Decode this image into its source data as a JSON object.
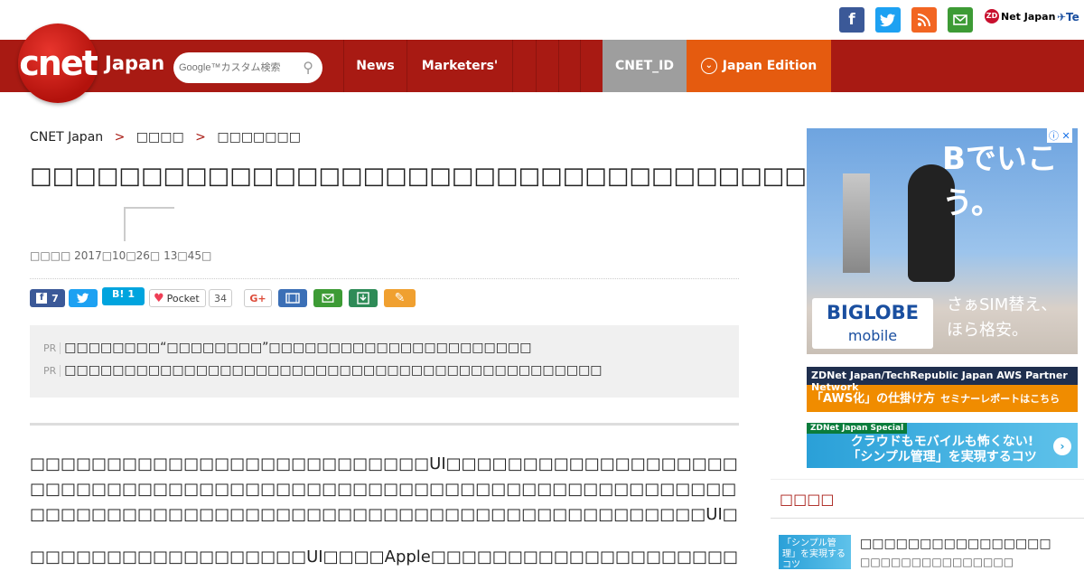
{
  "header": {
    "logo": "cnet",
    "site_name": "Japan",
    "search_placeholder": "Google™カスタム検索",
    "nav": [
      "News",
      "Marketers'",
      "",
      "",
      ""
    ],
    "cnet_id": "CNET_ID",
    "edition": "Japan Edition",
    "zdnet": "Net Japan",
    "zdnet_mark": "ZD",
    "social": {
      "facebook": "f",
      "twitter": "t",
      "rss": "rss",
      "mail": "mail"
    },
    "colors": {
      "bar": "#a81a13",
      "edition": "#e55b0f",
      "cnet_id": "#9e9e9e"
    }
  },
  "breadcrumb": {
    "home": "CNET Japan",
    "sep": ">",
    "c1": "□□□□",
    "c2": "□□□□□□□"
  },
  "article": {
    "title": "□□□□□□□□□□□□□□□□□□□□□□□□□□□□□□□□□□□□□",
    "meta": "□□□□ 2017□10□26□ 13□45□",
    "share": {
      "fb_count": "7",
      "hatena_count": "1",
      "pocket_label": "Pocket",
      "pocket_count": "34",
      "gplus": "G+"
    },
    "pr": [
      {
        "label": "PR",
        "text": "□□□□□□□□“□□□□□□□□”□□□□□□□□□□□□□□□□□□□□□□"
      },
      {
        "label": "PR",
        "text": "□□□□□□□□□□□□□□□□□□□□□□□□□□□□□□□□□□□□□□□□□□□□□"
      }
    ],
    "paragraphs": [
      "□□□□□□□□□□□□□□□□□□□□□□□□□□UI□□□□□□□□□□□□□□□□□□□□□□□□□□□□□□□□□□□□□□□□□□□□□□□□□□□□□□□□□□□□□□□□□□□□□□□□□□□□□□□□□□□□□□□□□□□□□□□□□□□□□□□□□□□□□UI□□□□□",
      "□□□□□□□□□□□□□□□□□□UI□□□□Apple□□□□□□□□□□□□□□□□□□□□□□□□□□□□□□□□□□□□□□□□□"
    ]
  },
  "ads": {
    "ad1": {
      "headline": "Bでいこう。",
      "sub1": "さぁSIM替え、",
      "sub2": "ほら格安。",
      "brand": "BIGLOBE",
      "brand_sub": "mobile",
      "info": "ⓘ",
      "close": "✕"
    },
    "ad2": {
      "top": "ZDNet Japan/TechRepublic Japan  AWS Partner Network",
      "main": "「AWS化」の仕掛け方",
      "sub": "セミナーレポートはこちら"
    },
    "ad3": {
      "tag": "ZDNet Japan Special",
      "line1": "クラウドもモバイルも怖くない!",
      "line2": "「シンプル管理」を実現するコツ",
      "arrow": "›"
    }
  },
  "sidebar": {
    "heading": "□□□□",
    "item": {
      "thumb": "「シンプル管理」を実現するコツ",
      "title": "□□□□□□□□□□□□□□□□",
      "sub": "□□□□□□□□□□□□□□□"
    }
  }
}
